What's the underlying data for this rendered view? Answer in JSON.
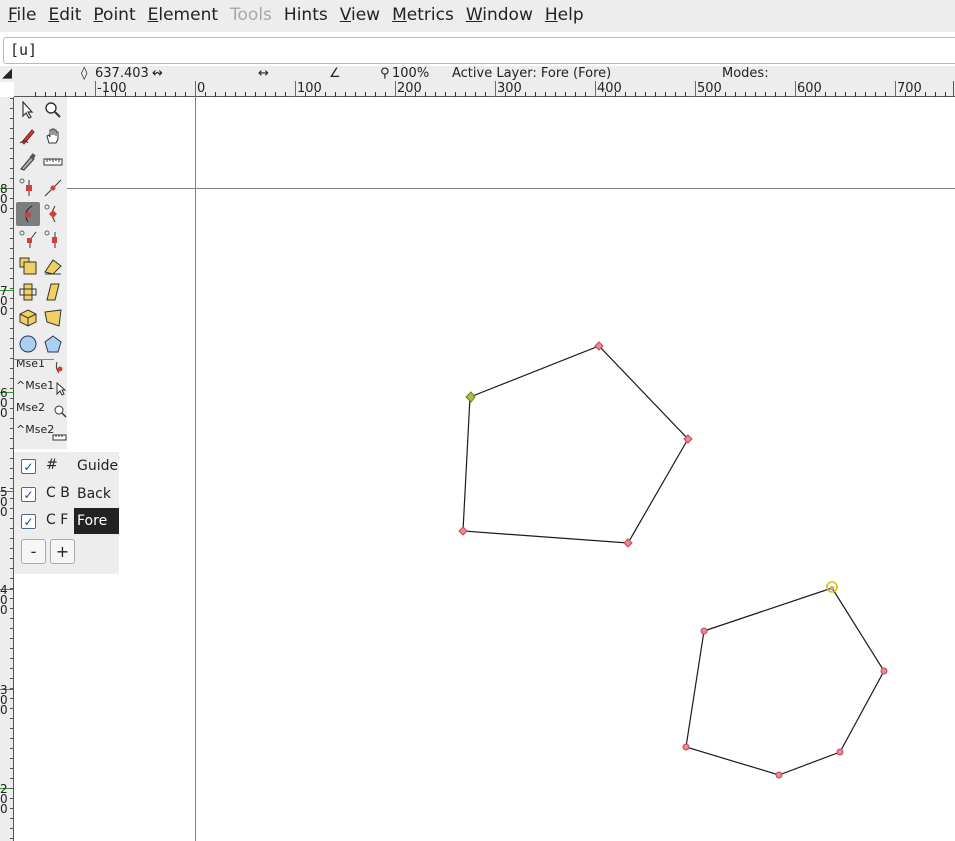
{
  "menubar": {
    "items": [
      {
        "label": "File",
        "mnemonic": "F",
        "rest": "ile",
        "disabled": false
      },
      {
        "label": "Edit",
        "mnemonic": "E",
        "rest": "dit",
        "disabled": false
      },
      {
        "label": "Point",
        "mnemonic": "P",
        "rest": "oint",
        "disabled": false
      },
      {
        "label": "Element",
        "mnemonic": "E",
        "rest": "lement",
        "disabled": false
      },
      {
        "label": "Tools",
        "mnemonic": "",
        "rest": "Tools",
        "disabled": true
      },
      {
        "label": "Hints",
        "mnemonic": "",
        "rest": "Hints",
        "disabled": false
      },
      {
        "label": "View",
        "mnemonic": "V",
        "rest": "iew",
        "disabled": false
      },
      {
        "label": "Metrics",
        "mnemonic": "M",
        "rest": "etrics",
        "disabled": false
      },
      {
        "label": "Window",
        "mnemonic": "W",
        "rest": "indow",
        "disabled": false
      },
      {
        "label": "Help",
        "mnemonic": "H",
        "rest": "elp",
        "disabled": false
      }
    ]
  },
  "glyph_field": {
    "value": "[u]"
  },
  "infobar": {
    "coord": "637.403",
    "zoom": "100%",
    "active_layer": "Active Layer: Fore (Fore)",
    "modes": "Modes:"
  },
  "hruler": {
    "labels": [
      "-100",
      "0",
      "100",
      "200",
      "300",
      "400",
      "500",
      "600",
      "700"
    ]
  },
  "vruler": {
    "labels": [
      "8\n0\n0",
      "7\n0\n0",
      "6\n0\n0",
      "5\n0\n0",
      "4\n0\n0",
      "3\n0\n0",
      "2\n0\n0"
    ]
  },
  "toolbox": {
    "tools": [
      "pointer-icon",
      "magnify-icon",
      "freehand-icon",
      "hand-scroll-icon",
      "knife-icon",
      "ruler-icon",
      "add-hvcurve-point-icon",
      "add-tangent-point-icon",
      "add-curve-point-icon",
      "add-corner-point-icon",
      "add-tangent-point-alt-icon",
      "add-point-alt-icon",
      "scale-icon",
      "rotate-icon",
      "flip-icon",
      "skew-icon",
      "rotate-3d-icon",
      "perspective-icon",
      "ellipse-icon",
      "polygon-icon"
    ],
    "active_tool": "add-curve-point-icon",
    "mouse_labels": [
      "Mse1",
      "^Mse1",
      "Mse2",
      "^Mse2"
    ]
  },
  "layers": {
    "rows": [
      {
        "code": "#",
        "name": "Guide",
        "checked": true,
        "selected": false
      },
      {
        "code": "C B",
        "name": "Back",
        "checked": true,
        "selected": false
      },
      {
        "code": "C F",
        "name": "Fore",
        "checked": true,
        "selected": true
      }
    ],
    "remove_label": "-",
    "add_label": "+"
  },
  "colors": {
    "point_fill": "#e88a94",
    "point_stroke": "#c8455a",
    "start_point": "#c8c800",
    "outline": "#1a1a1a",
    "guide_line": "#808080",
    "ruler_mark": "#2a9a2a"
  }
}
